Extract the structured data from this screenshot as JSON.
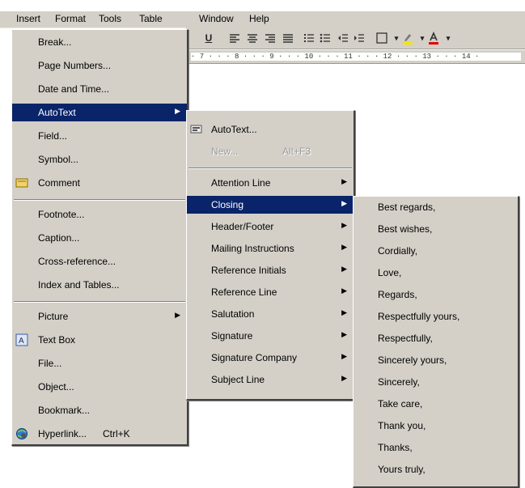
{
  "menubar": [
    "Insert",
    "Format",
    "Tools",
    "Table",
    "Window",
    "Help"
  ],
  "toolbar": {
    "underline": "U",
    "ruler_text": "· 7 · · · 8 · · · 9 · · · 10 · · · 11 · · · 12 · · · 13 · · · 14 ·"
  },
  "insert_menu": {
    "items": [
      {
        "label": "Break..."
      },
      {
        "label": "Page Numbers..."
      },
      {
        "label": "Date and Time..."
      },
      {
        "label": "AutoText",
        "submenu": true,
        "selected": true
      },
      {
        "label": "Field..."
      },
      {
        "label": "Symbol..."
      },
      {
        "label": "Comment",
        "icon": "comment-icon"
      },
      {
        "label": "Footnote..."
      },
      {
        "label": "Caption..."
      },
      {
        "label": "Cross-reference..."
      },
      {
        "label": "Index and Tables..."
      },
      {
        "label": "Picture",
        "submenu": true
      },
      {
        "label": "Text Box",
        "icon": "text-box-icon"
      },
      {
        "label": "File..."
      },
      {
        "label": "Object..."
      },
      {
        "label": "Bookmark..."
      },
      {
        "label": "Hyperlink...",
        "shortcut": "Ctrl+K",
        "icon": "hyperlink-icon"
      }
    ]
  },
  "autotext_menu": {
    "items": [
      {
        "label": "AutoText...",
        "icon": "autotext-icon"
      },
      {
        "label": "New...",
        "shortcut": "Alt+F3",
        "disabled": true
      },
      {
        "label": "Attention Line",
        "submenu": true
      },
      {
        "label": "Closing",
        "submenu": true,
        "selected": true
      },
      {
        "label": "Header/Footer",
        "submenu": true
      },
      {
        "label": "Mailing Instructions",
        "submenu": true
      },
      {
        "label": "Reference Initials",
        "submenu": true
      },
      {
        "label": "Reference Line",
        "submenu": true
      },
      {
        "label": "Salutation",
        "submenu": true
      },
      {
        "label": "Signature",
        "submenu": true
      },
      {
        "label": "Signature Company",
        "submenu": true
      },
      {
        "label": "Subject Line",
        "submenu": true
      }
    ]
  },
  "closing_menu": {
    "items": [
      "Best regards,",
      "Best wishes,",
      "Cordially,",
      "Love,",
      "Regards,",
      "Respectfully yours,",
      "Respectfully,",
      "Sincerely yours,",
      "Sincerely,",
      "Take care,",
      "Thank you,",
      "Thanks,",
      "Yours truly,"
    ]
  },
  "colors": {
    "menu_bg": "#d4d0c8",
    "highlight": "#0a246a"
  }
}
